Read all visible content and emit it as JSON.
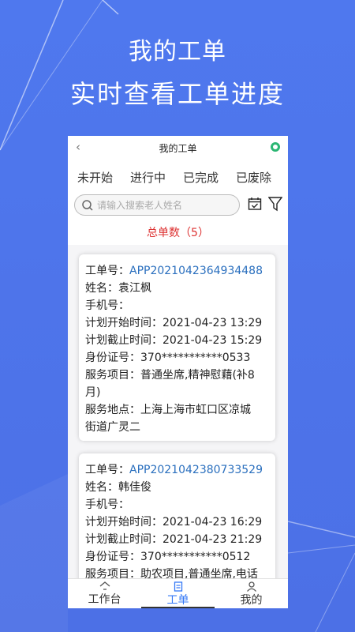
{
  "promo": {
    "line1": "我的工单",
    "line2": "实时查看工单进度"
  },
  "header": {
    "back_icon": "chevron-left",
    "title": "我的工单",
    "record_icon": "record-dot"
  },
  "tabs": [
    "未开始",
    "进行中",
    "已完成",
    "已废除"
  ],
  "active_tab": "未开始",
  "search": {
    "placeholder": "请输入搜索老人姓名"
  },
  "total_label": "总单数（5）",
  "orders": [
    {
      "order_no_label": "工单号：",
      "order_no": "APP2021042364934488",
      "name": "姓名：袁江枫",
      "phone": "手机号：",
      "start": "计划开始时间：2021-04-23 13:29",
      "end": "计划截止时间：2021-04-23 15:29",
      "id": "身份证号：370***********0533",
      "service_line1": "服务项目：普通坐席,精神慰藉(补8",
      "service_line2": "月)",
      "addr_line1": "服务地点：上海上海市虹口区凉城",
      "addr_line2": "街道广灵二"
    },
    {
      "order_no_label": "工单号：",
      "order_no": "APP2021042380733529",
      "name": "姓名：韩佳俊",
      "phone": "手机号：",
      "start": "计划开始时间：2021-04-23 16:29",
      "end": "计划截止时间：2021-04-23 21:29",
      "id": "身份证号：370***********0512",
      "service_line1": "服务项目：助农项目,普通坐席,电话"
    }
  ],
  "nav": [
    {
      "label": "工作台",
      "icon": "home-icon"
    },
    {
      "label": "工单",
      "icon": "document-icon"
    },
    {
      "label": "我的",
      "icon": "user-icon"
    }
  ],
  "colors": {
    "accent": "#3478f6",
    "total": "#dd3333",
    "order_no": "#2a6fbe",
    "background": "#4f78ee"
  }
}
